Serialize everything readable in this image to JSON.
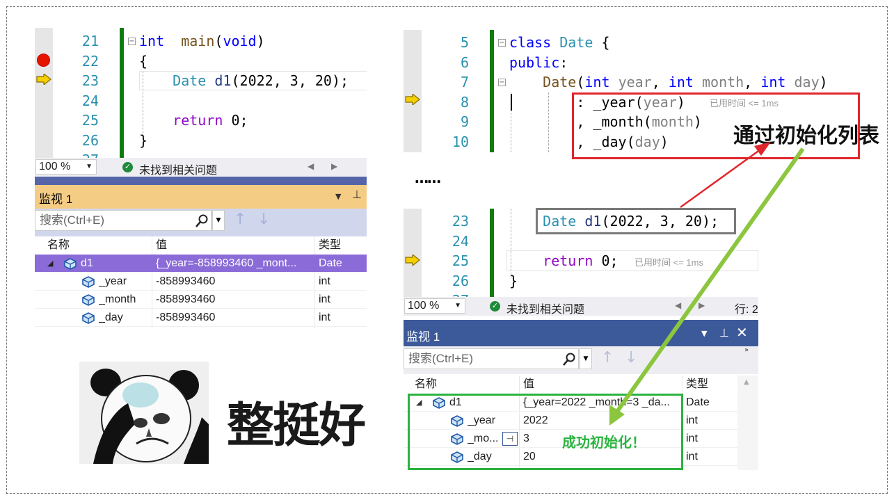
{
  "left_editor": {
    "line_numbers": [
      "21",
      "22",
      "23",
      "24",
      "25",
      "26",
      "27"
    ],
    "lines": [
      {
        "parts": [
          [
            "kw",
            "int"
          ],
          [
            "",
            "  "
          ],
          [
            "fn",
            "main"
          ],
          [
            "",
            "("
          ],
          [
            "kw",
            "void"
          ],
          [
            "",
            ")"
          ]
        ]
      },
      {
        "parts": [
          [
            "",
            "{"
          ]
        ]
      },
      {
        "parts": [
          [
            "",
            "    "
          ],
          [
            "ty",
            "Date"
          ],
          [
            "",
            " "
          ],
          [
            "vr",
            "d1"
          ],
          [
            "",
            "(2022, 3, 20);"
          ]
        ]
      },
      {
        "parts": [
          [
            "",
            ""
          ]
        ]
      },
      {
        "parts": [
          [
            "",
            "    "
          ],
          [
            "ret",
            "return"
          ],
          [
            "",
            " 0;"
          ]
        ]
      },
      {
        "parts": [
          [
            "",
            "}"
          ]
        ]
      },
      {
        "parts": [
          [
            "",
            ""
          ]
        ]
      }
    ]
  },
  "left_status": {
    "zoom": "100 %",
    "issues": "未找到相关问题"
  },
  "left_watch": {
    "title": "监视 1",
    "search_placeholder": "搜索(Ctrl+E)",
    "col_name": "名称",
    "col_value": "值",
    "col_type": "类型",
    "rows": [
      {
        "name": "d1",
        "value": "{_year=-858993460 _mont...",
        "type": "Date"
      },
      {
        "name": "_year",
        "value": "-858993460",
        "type": "int"
      },
      {
        "name": "_month",
        "value": "-858993460",
        "type": "int"
      },
      {
        "name": "_day",
        "value": "-858993460",
        "type": "int"
      }
    ]
  },
  "meme": {
    "caption": "整挺好"
  },
  "right_editor_top": {
    "line_numbers": [
      "5",
      "6",
      "7",
      "8",
      "9",
      "10"
    ],
    "lines": [
      {
        "parts": [
          [
            "kw",
            "class"
          ],
          [
            "",
            " "
          ],
          [
            "ty",
            "Date"
          ],
          [
            "",
            " {"
          ]
        ]
      },
      {
        "parts": [
          [
            "kw",
            "public"
          ],
          [
            "",
            ":"
          ]
        ]
      },
      {
        "parts": [
          [
            "",
            "    "
          ],
          [
            "fn",
            "Date"
          ],
          [
            "",
            "("
          ],
          [
            "kw",
            "int"
          ],
          [
            "",
            " "
          ],
          [
            "gray",
            "year"
          ],
          [
            "",
            ", "
          ],
          [
            "kw",
            "int"
          ],
          [
            "",
            " "
          ],
          [
            "gray",
            "month"
          ],
          [
            "",
            ", "
          ],
          [
            "kw",
            "int"
          ],
          [
            "",
            " "
          ],
          [
            "gray",
            "day"
          ],
          [
            "",
            ")"
          ]
        ]
      },
      {
        "parts": [
          [
            "",
            "        : "
          ],
          [
            "",
            ""
          ],
          [
            "",
            "_year("
          ],
          [
            "gray",
            "year"
          ],
          [
            "",
            ")"
          ]
        ]
      },
      {
        "parts": [
          [
            "",
            "        , _month("
          ],
          [
            "gray",
            "month"
          ],
          [
            "",
            ")"
          ]
        ]
      },
      {
        "parts": [
          [
            "",
            "        , _day("
          ],
          [
            "gray",
            "day"
          ],
          [
            "",
            ")"
          ]
        ]
      }
    ],
    "elapsed": "已用时间 <= 1ms"
  },
  "ellipsis": "……",
  "right_editor_bottom": {
    "line_numbers": [
      "23",
      "24",
      "25",
      "26",
      "27"
    ],
    "lines": [
      {
        "parts": [
          [
            "",
            "    "
          ],
          [
            "ty",
            "Date"
          ],
          [
            "",
            " "
          ],
          [
            "vr",
            "d1"
          ],
          [
            "",
            "(2022, 3, 20);"
          ]
        ]
      },
      {
        "parts": [
          [
            "",
            ""
          ]
        ]
      },
      {
        "parts": [
          [
            "",
            "    "
          ],
          [
            "ret",
            "return"
          ],
          [
            "",
            " 0;"
          ]
        ]
      },
      {
        "parts": [
          [
            "",
            "}"
          ]
        ]
      },
      {
        "parts": [
          [
            "",
            ""
          ]
        ]
      }
    ],
    "elapsed": "已用时间 <= 1ms"
  },
  "right_status": {
    "zoom": "100 %",
    "issues": "未找到相关问题",
    "line": "行: 2"
  },
  "right_watch": {
    "title": "监视 1",
    "search_placeholder": "搜索(Ctrl+E)",
    "col_name": "名称",
    "col_value": "值",
    "col_type": "类型",
    "rows": [
      {
        "name": "d1",
        "value": "{_year=2022 _month=3 _da...",
        "type": "Date"
      },
      {
        "name": "_year",
        "value": "2022",
        "type": "int"
      },
      {
        "name": "_mo...",
        "value": "3",
        "type": "int"
      },
      {
        "name": "_day",
        "value": "20",
        "type": "int"
      }
    ]
  },
  "annotations": {
    "init_list": "通过初始化列表",
    "success": "成功初始化！"
  },
  "colors": {
    "watch_title_left": "#f5cc84",
    "watch_title_right": "#3c5a9a",
    "selected_row": "#8b6bd8",
    "red_box": "#e0262a",
    "green_box": "#2cb340",
    "breakpoint": "#e51400"
  }
}
